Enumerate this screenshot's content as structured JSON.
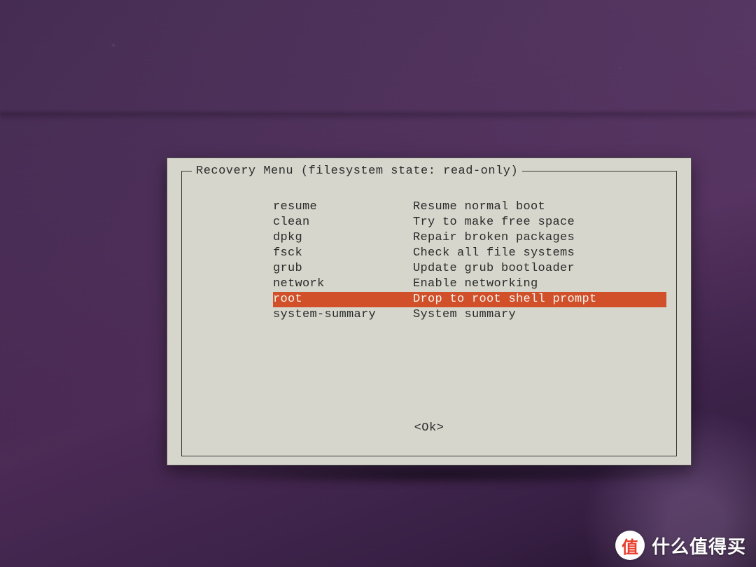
{
  "dialog": {
    "title": "Recovery Menu (filesystem state: read-only)",
    "ok_label": "<Ok>",
    "selected_index": 6,
    "items": [
      {
        "key": "resume",
        "desc": "Resume normal boot"
      },
      {
        "key": "clean",
        "desc": "Try to make free space"
      },
      {
        "key": "dpkg",
        "desc": "Repair broken packages"
      },
      {
        "key": "fsck",
        "desc": "Check all file systems"
      },
      {
        "key": "grub",
        "desc": "Update grub bootloader"
      },
      {
        "key": "network",
        "desc": "Enable networking"
      },
      {
        "key": "root",
        "desc": "Drop to root shell prompt"
      },
      {
        "key": "system-summary",
        "desc": "System summary"
      }
    ]
  },
  "watermark": {
    "badge_char": "值",
    "text": "什么值得买"
  },
  "colors": {
    "highlight": "#d1502a",
    "panel": "#d6d6cc"
  }
}
